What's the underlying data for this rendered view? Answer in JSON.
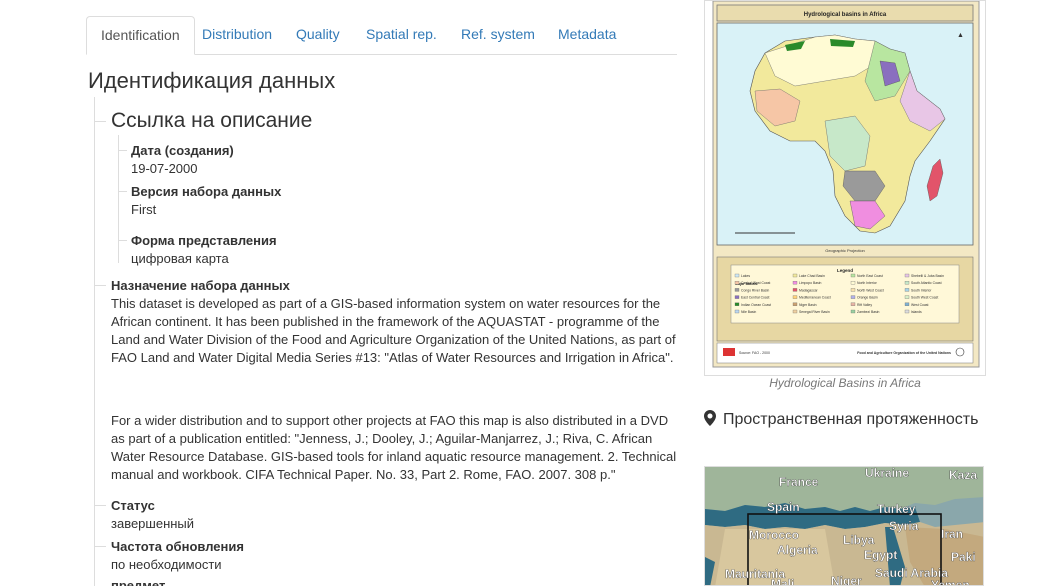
{
  "tabs": [
    {
      "label": "Identification",
      "active": true
    },
    {
      "label": "Distribution"
    },
    {
      "label": "Quality"
    },
    {
      "label": "Spatial rep."
    },
    {
      "label": "Ref. system"
    },
    {
      "label": "Metadata"
    }
  ],
  "main": {
    "title": "Идентификация данных",
    "citation": {
      "heading": "Ссылка на описание",
      "date_label": "Дата (создания)",
      "date_value": "19-07-2000",
      "edition_label": "Версия набора данных",
      "edition_value": "First",
      "form_label": "Форма представления",
      "form_value": "цифровая карта"
    },
    "purpose_label": "Назначение набора данных",
    "purpose_p1": "This dataset is developed as part of a GIS-based information system on water resources for the African continent. It has been published in the framework of the AQUASTAT - programme of the Land and Water Division of the Food and Agriculture Organization of the United Nations, as part of FAO Land and Water Digital Media Series #13: \"Atlas of Water Resources and Irrigation in Africa\".",
    "purpose_p2": "For a wider distribution and to support other projects at FAO this map is also distributed in a DVD as part of a publication entitled: \"Jenness, J.; Dooley, J.; Aguilar-Manjarrez, J.; Riva, C. African Water Resource Database. GIS-based tools for inland aquatic resource management. 2. Technical manual and workbook. CIFA Technical Paper. No. 33, Part 2. Rome, FAO. 2007. 308 p.\"",
    "status_label": "Статус",
    "status_value": "завершенный",
    "frequency_label": "Частота обновления",
    "frequency_value": "по необходимости",
    "next_label": "предмет"
  },
  "thumbnail": {
    "map_title": "Hydrological basins in Africa",
    "legend_title": "Legend",
    "legend_subtitle": "Major basins:",
    "projection": "Geographic Projection",
    "footer_left": "Source: FAO - 2000",
    "footer_right": "Food and Agriculture Organization of the United Nations",
    "caption": "Hydrological Basins in Africa",
    "legend_items": [
      "Lakes",
      "Lake Chad Basin",
      "North East Coast",
      "Shebelli & Juba Basin",
      "Central West Coast",
      "Limpopo Basin",
      "North Interior",
      "South Atlantic Coast",
      "Congo River Basin",
      "Madagascar",
      "North West Coast",
      "South Interior",
      "East Central Coast",
      "Mediterranean Coast",
      "Orange Basin",
      "South West Coast",
      "Indian Ocean Coast",
      "Niger Basin",
      "Rift Valley",
      "West Coast",
      "Nile Basin",
      "Senegal River Basin",
      "Zambezi Basin",
      "Islands"
    ]
  },
  "extent": {
    "title": "Пространственная протяженность",
    "labels": [
      "Ukraine",
      "Kaza",
      "France",
      "Spain",
      "Turkey",
      "Syria",
      "Iran",
      "Morocco",
      "Libya",
      "Algeria",
      "Egypt",
      "Paki",
      "Mauritania",
      "Mali",
      "Niger",
      "Saudi Arabia",
      "Yemen"
    ]
  },
  "colors": {
    "link": "#337ab7",
    "border": "#dddddd",
    "map_sea": "#5d8fa6",
    "thumb_bg": "#f3e8c4",
    "africa_sea": "#d9f2f7"
  }
}
